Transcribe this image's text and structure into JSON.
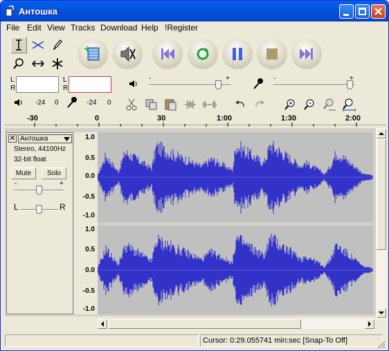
{
  "window": {
    "title": "Антошка"
  },
  "menu": [
    "File",
    "Edit",
    "View",
    "Tracks",
    "Download",
    "Help",
    "!Register"
  ],
  "meters": {
    "left": "L",
    "right": "R",
    "db1": "-24",
    "db2": "-24",
    "zero1": "0",
    "zero2": "0"
  },
  "mixer": {
    "minus": "-",
    "plus": "+"
  },
  "ruler": {
    "ticks": [
      "-30",
      "0",
      "30",
      "1:00",
      "1:30",
      "2:00"
    ]
  },
  "track": {
    "name": "Антошка",
    "format": "Stereo, 44100Hz",
    "bits": "32-bit float",
    "mute": "Mute",
    "solo": "Solo",
    "gain_minus": "-",
    "gain_plus": "+",
    "pan_left": "L",
    "pan_right": "R",
    "yticks": [
      "1.0",
      "0.5",
      "0.0",
      "-0.5",
      "-1.0"
    ]
  },
  "status": {
    "left": "",
    "cursor": "Cursor: 0:29.055741 min:sec",
    "snap": "[Snap-To Off]"
  },
  "colors": {
    "title": "#0454e0",
    "wave": "#3232c8",
    "wave_bg": "#c0c0c0"
  }
}
